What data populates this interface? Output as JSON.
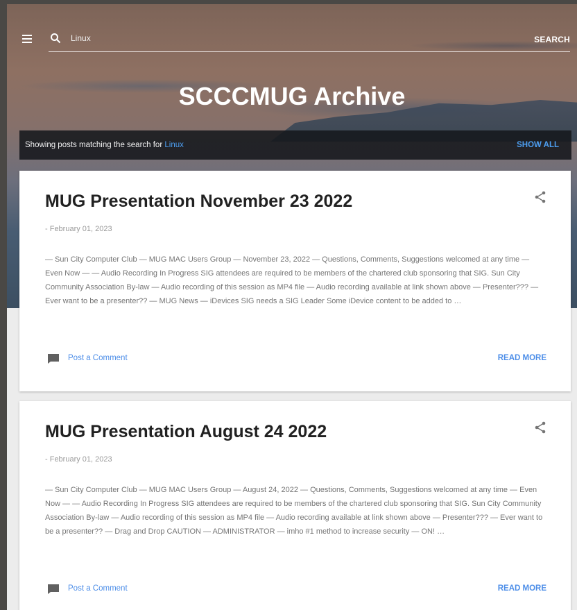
{
  "header": {
    "search_value": "Linux",
    "search_button": "SEARCH",
    "site_title": "SCCCMUG Archive"
  },
  "status": {
    "prefix": "Showing posts matching the search for",
    "query": "Linux",
    "show_all": "SHOW ALL"
  },
  "posts": [
    {
      "title": "MUG Presentation November 23 2022",
      "date": "- February 01, 2023",
      "snippet": "— Sun City Computer Club — MUG MAC Users Group — November 23, 2022 — Questions, Comments, Suggestions welcomed at any time — Even Now — — Audio Recording In Progress SIG attendees are required to be members of the chartered club sponsoring that SIG. Sun City Community Association By-law — Audio recording of this session as MP4 file — Audio recording available at link shown above — Presenter??? — Ever want to be a presenter?? — MUG News — iDevices SIG needs a SIG Leader Some iDevice content to be added to …",
      "comment_label": "Post a Comment",
      "read_more": "READ MORE"
    },
    {
      "title": "MUG Presentation August 24 2022",
      "date": "- February 01, 2023",
      "snippet": "— Sun City Computer Club — MUG MAC Users Group — August 24, 2022 — Questions, Comments, Suggestions welcomed at any time — Even Now — — Audio Recording In Progress SIG attendees are required to be members of the chartered club sponsoring that SIG. Sun City Community Association By-law — Audio recording of this session as MP4 file — Audio recording available at link shown above — Presenter??? — Ever want to be a presenter?? — Drag and Drop CAUTION — ADMINISTRATOR — imho #1 method to increase security — ON! …",
      "comment_label": "Post a Comment",
      "read_more": "READ MORE"
    }
  ],
  "icons": {
    "menu": "menu-icon",
    "search": "search-icon",
    "share": "share-icon",
    "comment": "comment-icon"
  },
  "colors": {
    "accent": "#4d8ee8",
    "title": "#212121",
    "status_bar": "#16181c"
  }
}
